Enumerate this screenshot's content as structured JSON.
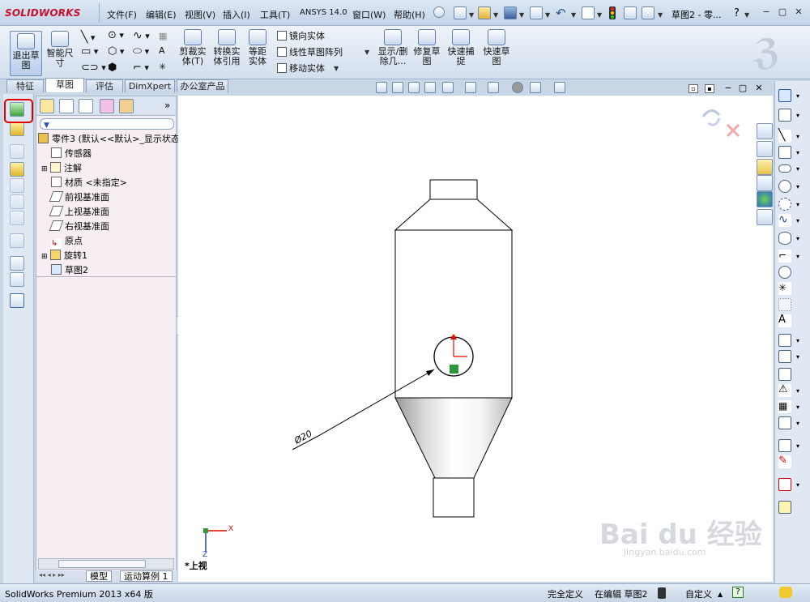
{
  "app": {
    "logo": "SOLIDWORKS"
  },
  "menus": [
    "文件(F)",
    "编辑(E)",
    "视图(V)",
    "插入(I)",
    "工具(T)",
    "ANSYS 14.0",
    "窗口(W)",
    "帮助(H)"
  ],
  "document_title": "草图2 - 零...",
  "help_label": "?",
  "command_manager": {
    "exit_sketch": "退出草图",
    "smart_dimension": "智能尺寸",
    "trim": "剪裁实体(T)",
    "convert": "转换实体引用",
    "offset": "等距实体",
    "mirror": "镜向实体",
    "linear_pattern": "线性草图阵列",
    "move": "移动实体",
    "display_relations": "显示/删除几...",
    "repair_sketch": "修复草图",
    "quick_snaps": "快速捕捉",
    "rapid_sketch": "快速草图"
  },
  "tabs": [
    "特征",
    "草图",
    "评估",
    "DimXpert",
    "办公室产品"
  ],
  "active_tab": "草图",
  "feature_tree": {
    "root": "零件3 (默认<<默认>_显示状态",
    "items": [
      "传感器",
      "注解",
      "材质 <未指定>",
      "前视基准面",
      "上视基准面",
      "右视基准面",
      "原点",
      "旋转1",
      "草图2"
    ]
  },
  "bottom_tabs": [
    "模型",
    "运动算例 1"
  ],
  "drawing": {
    "dimension": "Ø20",
    "view_label": "*上视",
    "axis_x": "X",
    "axis_z": "Z"
  },
  "status": {
    "product": "SolidWorks Premium 2013 x64 版",
    "state": "完全定义",
    "editing": "在编辑 草图2",
    "units": "自定义"
  },
  "watermark": {
    "brand": "Bai du 经验",
    "url": "jingyan.baidu.com"
  }
}
